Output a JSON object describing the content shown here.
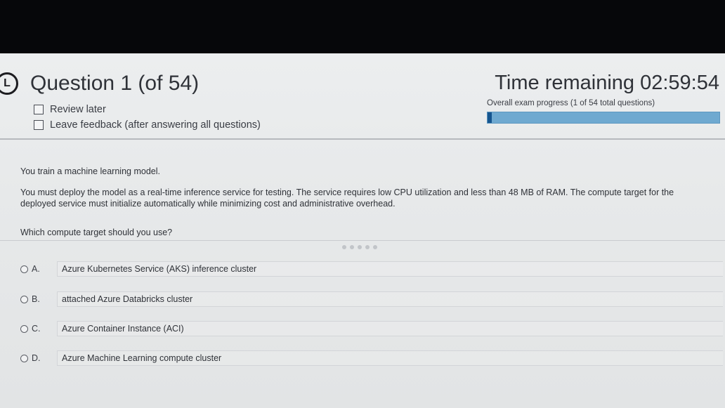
{
  "header": {
    "question_title": "Question 1 (of 54)",
    "review_later": "Review later",
    "leave_feedback": "Leave feedback (after answering all questions)",
    "time_remaining": "Time remaining 02:59:54",
    "progress_label": "Overall exam progress (1 of 54 total questions)",
    "progress_fraction": 0.0185
  },
  "question": {
    "line1": "You train a machine learning model.",
    "line2": "You must deploy the model as a real-time inference service for testing. The service requires low CPU utilization and less than 48 MB of RAM. The compute target for the deployed service must initialize automatically while minimizing cost and administrative overhead.",
    "prompt": "Which compute target should you use?"
  },
  "options": [
    {
      "letter": "A.",
      "text": "Azure Kubernetes Service (AKS) inference cluster"
    },
    {
      "letter": "B.",
      "text": "attached Azure Databricks cluster"
    },
    {
      "letter": "C.",
      "text": "Azure Container Instance (ACI)"
    },
    {
      "letter": "D.",
      "text": "Azure Machine Learning compute cluster"
    }
  ],
  "colors": {
    "progress_fill": "#15558f",
    "progress_track": "#6fa9d0"
  },
  "icons": {
    "back": "back-arrow-circle-icon"
  }
}
